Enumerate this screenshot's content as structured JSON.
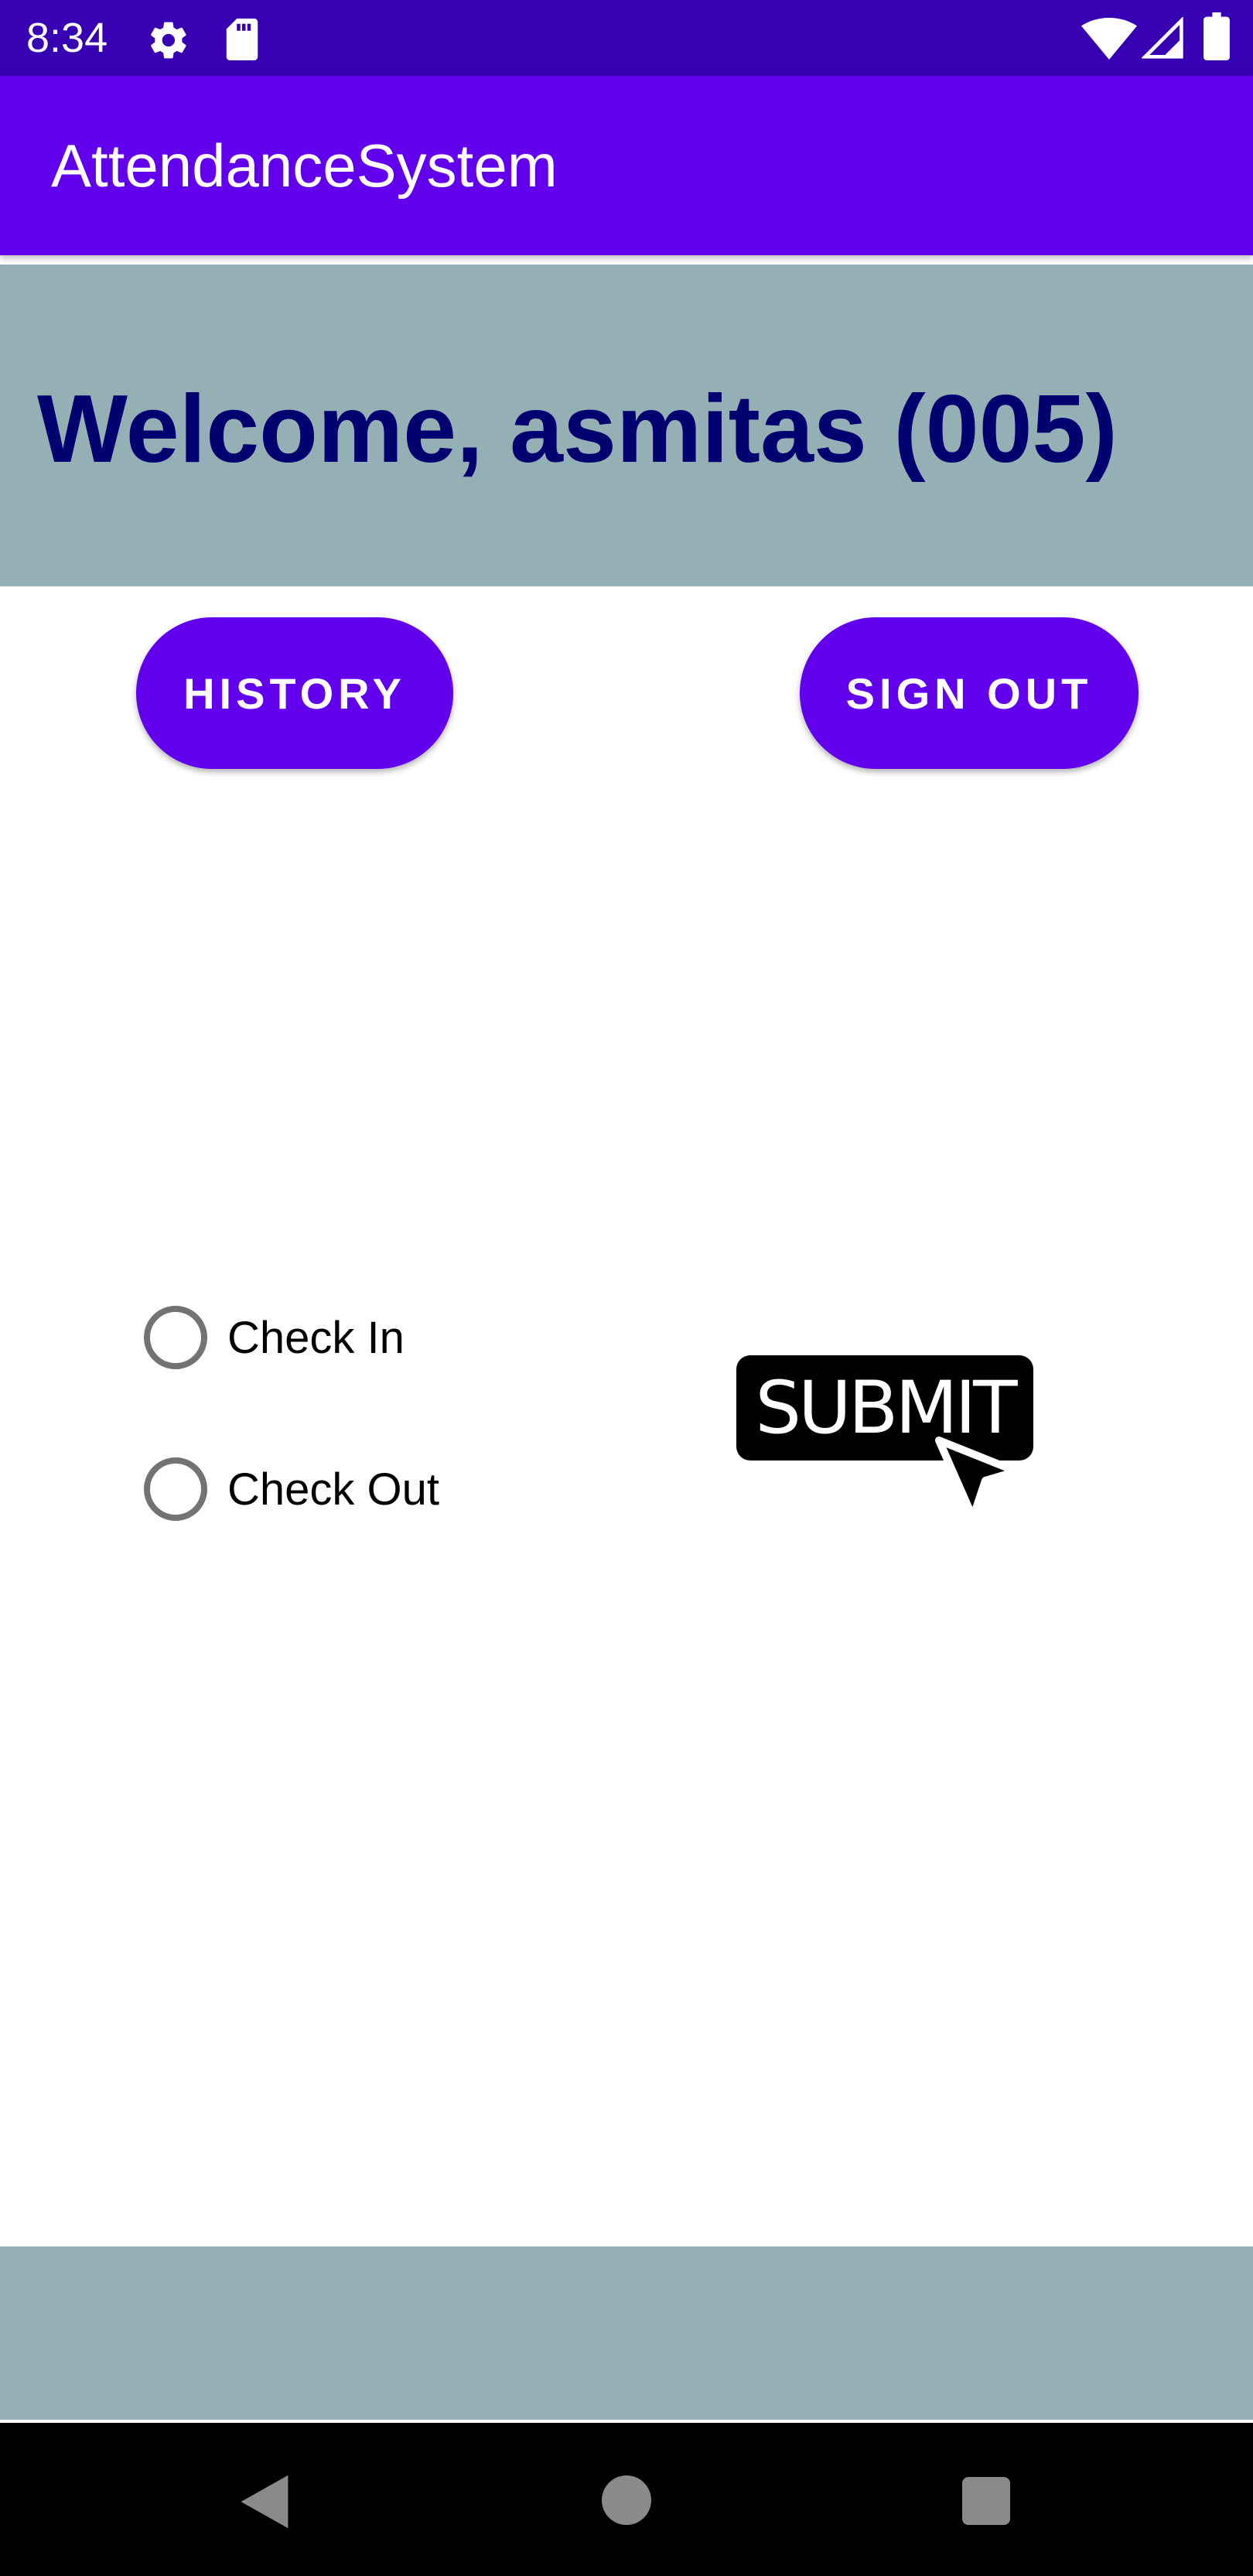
{
  "status_bar": {
    "time": "8:34",
    "icons": [
      "gear-icon",
      "sd-card-icon",
      "wifi-icon",
      "signal-icon",
      "battery-icon"
    ]
  },
  "app_bar": {
    "title": "AttendanceSystem"
  },
  "welcome": {
    "text": "Welcome, asmitas (005)"
  },
  "buttons": {
    "history": "HISTORY",
    "sign_out": "SIGN OUT"
  },
  "attendance_options": [
    {
      "label": "Check In",
      "selected": false
    },
    {
      "label": "Check Out",
      "selected": false
    }
  ],
  "submit": {
    "label": "SUBMIT"
  },
  "nav_bar": {
    "icons": [
      "back-icon",
      "home-icon",
      "recents-icon"
    ]
  },
  "colors": {
    "status_bar": "#3700b3",
    "primary": "#6200ee",
    "banner": "#95b0b5",
    "welcome_text": "#01016f",
    "radio_border": "#737373"
  }
}
